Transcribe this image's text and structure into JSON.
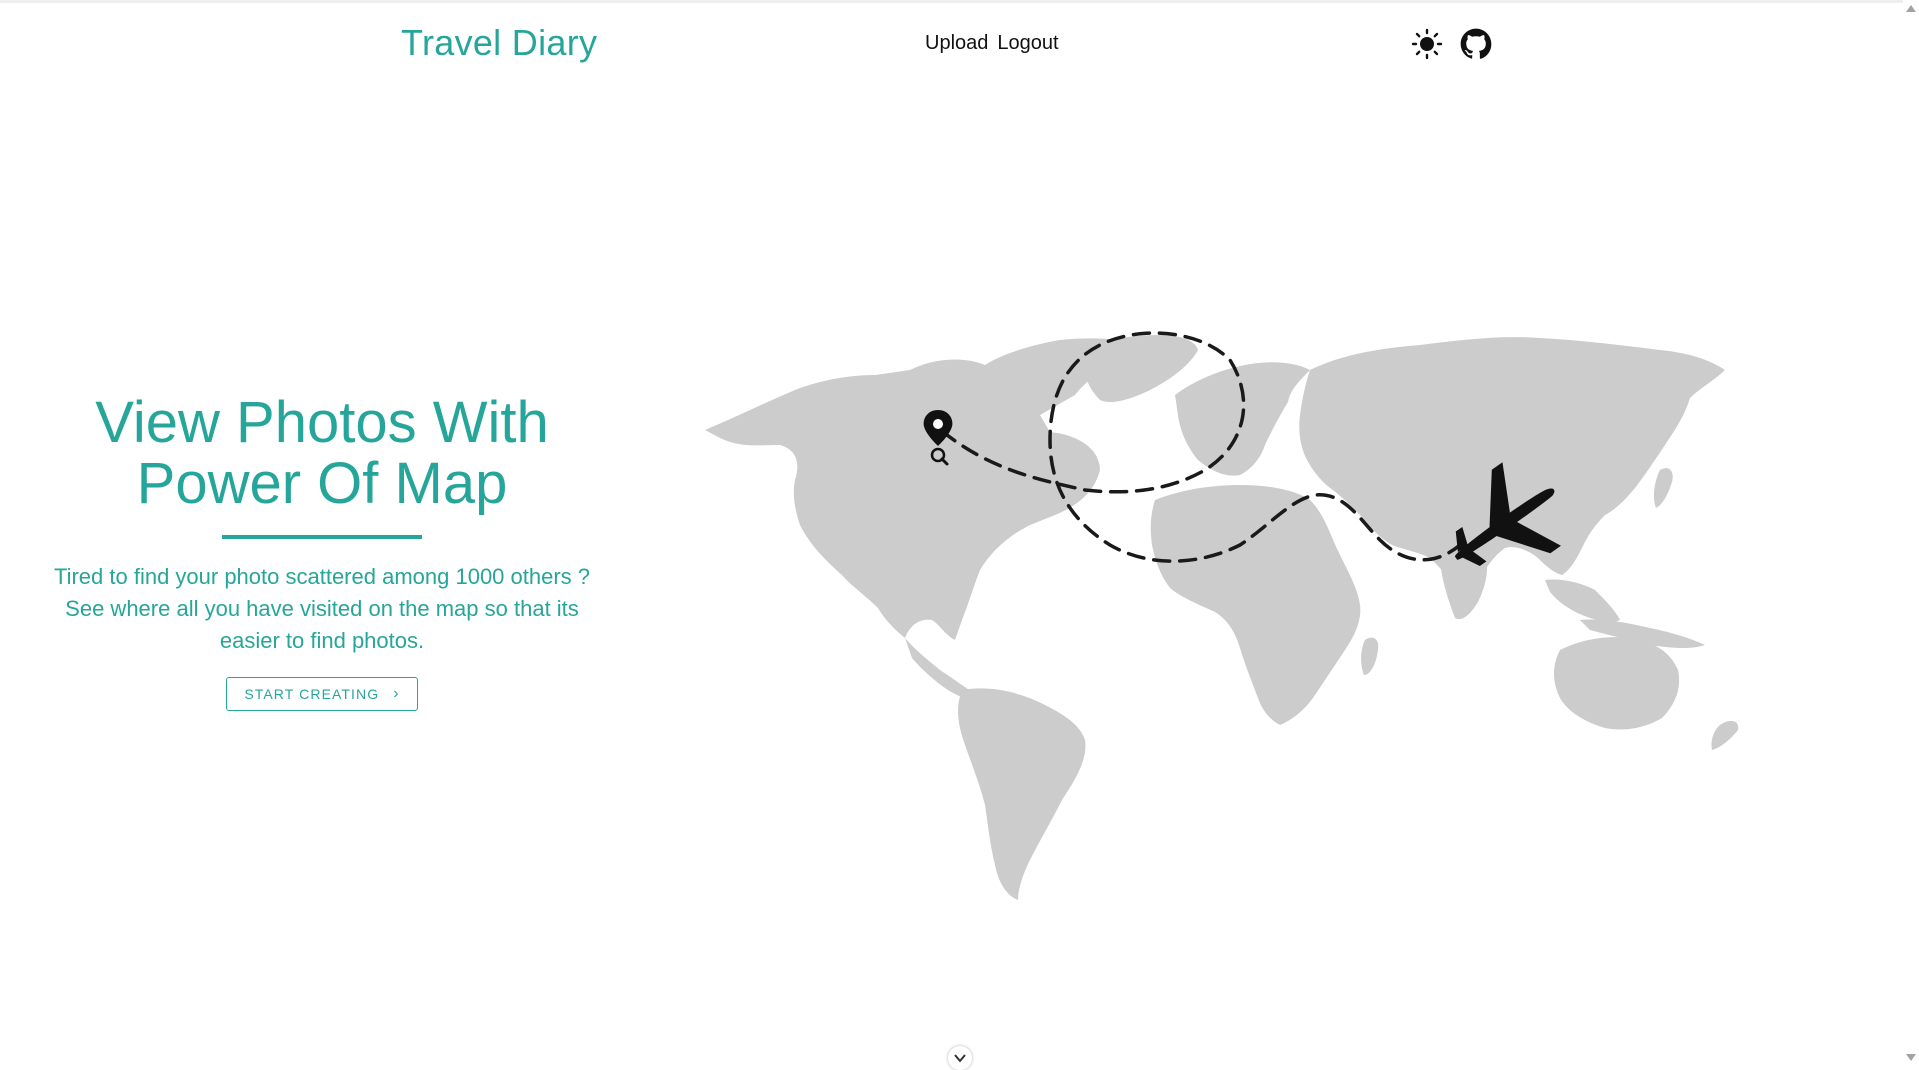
{
  "header": {
    "brand": "Travel Diary",
    "nav": {
      "upload": "Upload",
      "logout": "Logout"
    },
    "icons": {
      "theme_toggle": "sun-icon",
      "github": "github-icon"
    }
  },
  "hero": {
    "title_line1": "View Photos With",
    "title_line2": "Power Of Map",
    "desc_line1": "Tired to find your photo scattered among 1000 others ?",
    "desc_line2": "See where all you have visited on the map so that its",
    "desc_line3": "easier to find photos.",
    "cta_label": "START CREATING",
    "cta_icon": "chevron-right-icon"
  },
  "illustration": {
    "map": "world-map",
    "marker": "map-pin-icon",
    "plane": "airplane-icon",
    "route": "dashed-flight-path"
  },
  "scroll_hint_icon": "chevron-down-icon",
  "colors": {
    "accent": "#26a69a",
    "map_land": "#cccccc",
    "text_dark": "#111111"
  }
}
